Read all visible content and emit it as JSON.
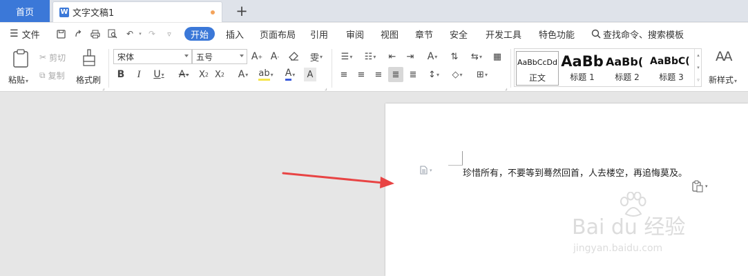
{
  "tabs": {
    "home": "首页",
    "doc_icon": "W",
    "document": "文字文稿1"
  },
  "menu": {
    "file": "文件",
    "items": [
      "开始",
      "插入",
      "页面布局",
      "引用",
      "审阅",
      "视图",
      "章节",
      "安全",
      "开发工具",
      "特色功能"
    ],
    "search": "查找命令、搜索模板"
  },
  "ribbon": {
    "paste": "粘贴",
    "cut": "剪切",
    "copy": "复制",
    "format_painter": "格式刷",
    "font": "宋体",
    "font_size": "五号",
    "styles": [
      {
        "preview": "AaBbCcDd",
        "name": "正文"
      },
      {
        "preview": "AaBb",
        "name": "标题 1"
      },
      {
        "preview": "AaBb(",
        "name": "标题 2"
      },
      {
        "preview": "AaBbC(",
        "name": "标题 3"
      }
    ],
    "new_style": "新样式"
  },
  "document": {
    "text": "珍惜所有，不要等到蓦然回首，人去楼空，再追悔莫及。"
  },
  "watermark": {
    "logo": "Bai du 经验",
    "url": "jingyan.baidu.com"
  },
  "colors": {
    "accent": "#3b78d8",
    "arrow": "#e84444",
    "highlight": "#f5e44a",
    "font_color": "#3b5bdb"
  }
}
